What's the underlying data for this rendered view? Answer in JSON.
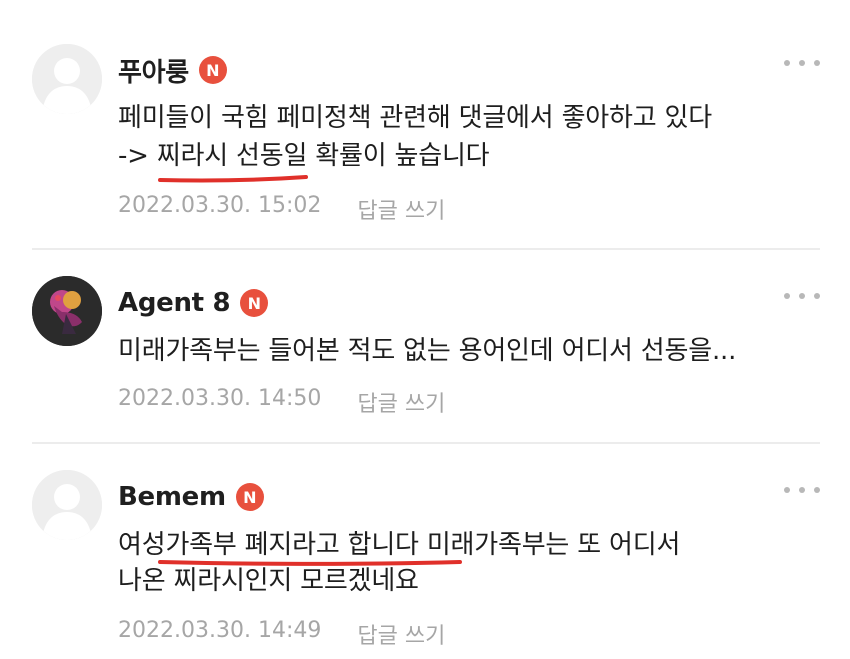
{
  "comments": [
    {
      "author": "푸아룽",
      "badge": "N",
      "line1": "페미들이 국힘 페미정책 관련해 댓글에서 좋아하고 있다",
      "line2": "-> 찌라시 선동일 확률이 높습니다",
      "timestamp": "2022.03.30. 15:02",
      "reply_label": "답글 쓰기"
    },
    {
      "author": "Agent 8",
      "badge": "N",
      "line1": "미래가족부는 들어본 적도 없는 용어인데 어디서 선동을...",
      "timestamp": "2022.03.30. 14:50",
      "reply_label": "답글 쓰기"
    },
    {
      "author": "Bemem",
      "badge": "N",
      "line1": "여성가족부 폐지라고 합니다 미래가족부는 또 어디서",
      "line2": "나온 찌라시인지 모르겠네요",
      "timestamp": "2022.03.30. 14:49",
      "reply_label": "답글 쓰기"
    }
  ],
  "colors": {
    "badge": "#e8503d",
    "underline": "#e0302a",
    "meta_text": "#a6a6a6",
    "divider": "#ececec"
  },
  "icons": {
    "more": "more-dots-icon",
    "default_avatar": "default-avatar-icon"
  }
}
